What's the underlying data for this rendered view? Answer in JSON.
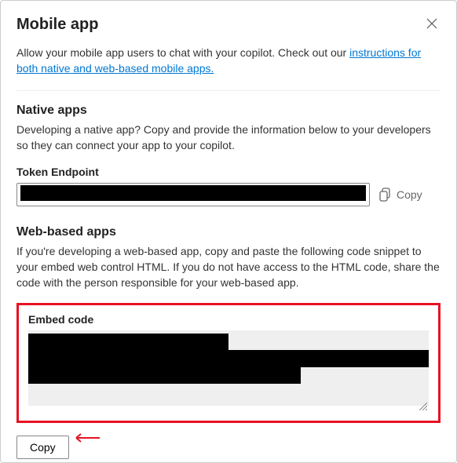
{
  "header": {
    "title": "Mobile app"
  },
  "intro": {
    "text_before_link": "Allow your mobile app users to chat with your copilot. Check out our ",
    "link_text": "instructions for both native and web-based mobile apps.",
    "text_after_link": ""
  },
  "native": {
    "title": "Native apps",
    "desc": "Developing a native app? Copy and provide the information below to your developers so they can connect your app to your copilot.",
    "token_label": "Token Endpoint",
    "token_value": "",
    "copy_label": "Copy"
  },
  "web": {
    "title": "Web-based apps",
    "desc": "If you're developing a web-based app, copy and paste the following code snippet to your embed web control HTML. If you do not have access to the HTML code, share the code with the person responsible for your web-based app.",
    "embed_label": "Embed code",
    "embed_value": "",
    "copy_button": "Copy"
  }
}
